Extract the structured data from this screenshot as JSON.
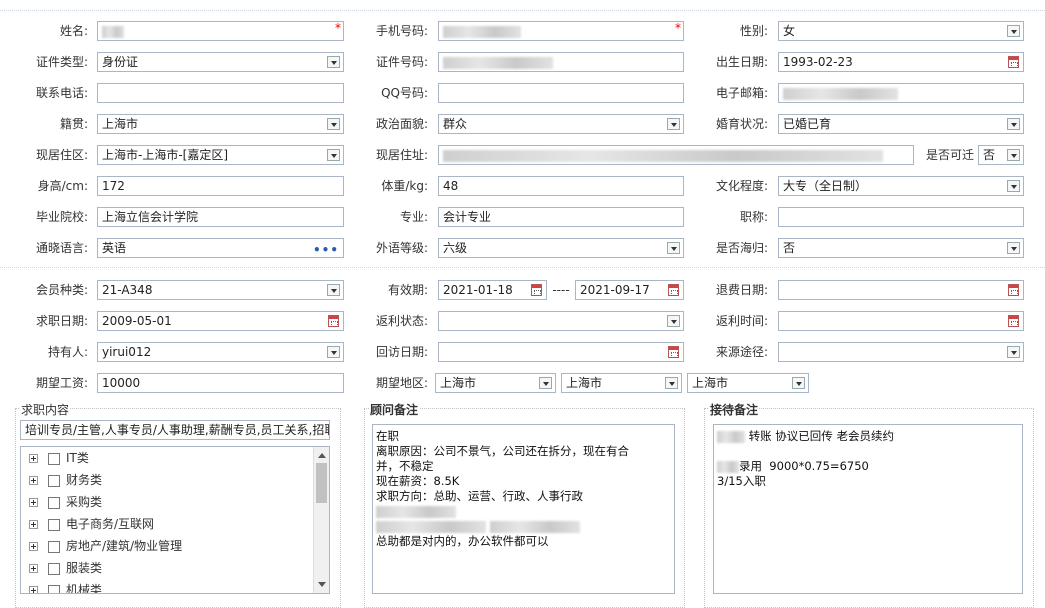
{
  "form": {
    "name": {
      "label": "姓名:",
      "value": ""
    },
    "mobile": {
      "label": "手机号码:",
      "value": ""
    },
    "gender": {
      "label": "性别:",
      "value": "女"
    },
    "id_type": {
      "label": "证件类型:",
      "value": "身份证"
    },
    "id_no": {
      "label": "证件号码:",
      "value": ""
    },
    "birth_date": {
      "label": "出生日期:",
      "value": "1993-02-23"
    },
    "phone": {
      "label": "联系电话:",
      "value": ""
    },
    "qq": {
      "label": "QQ号码:",
      "value": ""
    },
    "email": {
      "label": "电子邮箱:",
      "value": ""
    },
    "native_place": {
      "label": "籍贯:",
      "value": "上海市"
    },
    "political": {
      "label": "政治面貌:",
      "value": "群众"
    },
    "marital": {
      "label": "婚育状况:",
      "value": "已婚已育"
    },
    "residence_area": {
      "label": "现居住区:",
      "value": "上海市-上海市-[嘉定区]"
    },
    "residence_addr": {
      "label": "现居住址:",
      "value": ""
    },
    "relocate": {
      "label": "是否可迁",
      "value": "否"
    },
    "height": {
      "label": "身高/cm:",
      "value": "172"
    },
    "weight": {
      "label": "体重/kg:",
      "value": "48"
    },
    "education": {
      "label": "文化程度:",
      "value": "大专（全日制）"
    },
    "school": {
      "label": "毕业院校:",
      "value": "上海立信会计学院"
    },
    "major": {
      "label": "专业:",
      "value": "会计专业"
    },
    "title": {
      "label": "职称:",
      "value": ""
    },
    "language": {
      "label": "通晓语言:",
      "value": "英语"
    },
    "lang_level": {
      "label": "外语等级:",
      "value": "六级"
    },
    "returnee": {
      "label": "是否海归:",
      "value": "否"
    }
  },
  "membership": {
    "type": {
      "label": "会员种类:",
      "value": "21-A348"
    },
    "valid": {
      "label": "有效期:",
      "from": "2021-01-18",
      "sep": "----",
      "to": "2021-09-17"
    },
    "refund_date": {
      "label": "退费日期:",
      "value": ""
    },
    "job_date": {
      "label": "求职日期:",
      "value": "2009-05-01"
    },
    "rebate_status": {
      "label": "返利状态:",
      "value": ""
    },
    "rebate_time": {
      "label": "返利时间:",
      "value": ""
    },
    "holder": {
      "label": "持有人:",
      "value": "yirui012"
    },
    "visit_date": {
      "label": "回访日期:",
      "value": ""
    },
    "source": {
      "label": "来源途径:",
      "value": ""
    },
    "salary": {
      "label": "期望工资:",
      "value": "10000"
    },
    "region": {
      "label": "期望地区:",
      "province": "上海市",
      "city": "上海市",
      "district": "上海市"
    }
  },
  "job_panel": {
    "title": "求职内容",
    "summary": "培训专员/主管,人事专员/人事助理,薪酬专员,员工关系,招聘",
    "categories": [
      "IT类",
      "财务类",
      "采购类",
      "电子商务/互联网",
      "房地产/建筑/物业管理",
      "服装类",
      "机械类"
    ]
  },
  "advisor_panel": {
    "title": "顾问备注",
    "lines": [
      "在职",
      "离职原因：公司不景气，公司还在拆分，现在有合",
      "并，不稳定",
      "现在薪资：8.5K",
      "求职方向：总助、运营、行政、人事行政",
      "总助都是对内的，办公软件都可以"
    ]
  },
  "reception_panel": {
    "title": "接待备注",
    "line1": "转账 协议已回传 老会员续约",
    "line2": "录用  9000*0.75=6750",
    "line3": "3/15入职"
  },
  "colors": {
    "border": "#aab6c6",
    "required": "#ee0000",
    "label": "#333333"
  }
}
